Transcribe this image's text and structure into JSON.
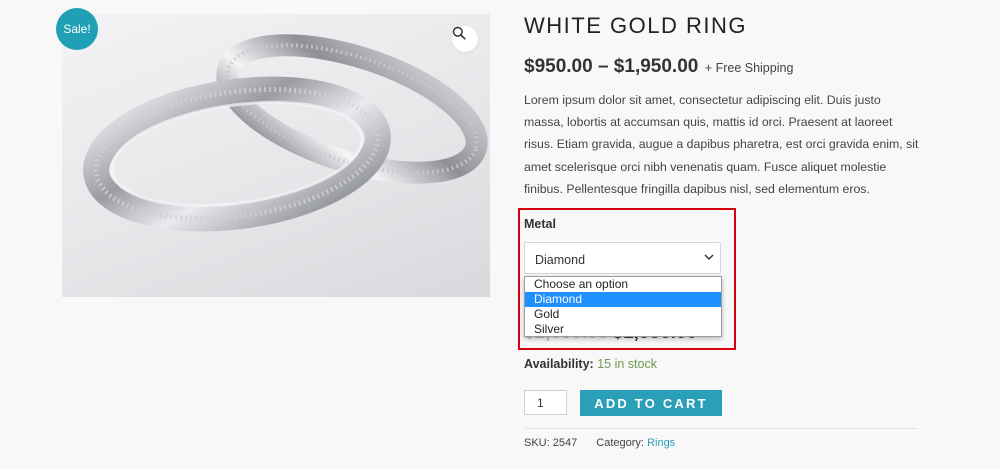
{
  "product": {
    "sale_badge": "Sale!",
    "title": "WHITE GOLD RING",
    "price_range": "$950.00 – $1,950.00",
    "shipping_note": "+ Free Shipping",
    "description": "Lorem ipsum dolor sit amet, consectetur adipiscing elit. Duis justo massa, lobortis at accumsan quis, mattis id orci. Praesent at laoreet risus. Etiam gravida, augue a dapibus pharetra, est orci gravida enim, sit amet scelerisque orci nibh venenatis quam. Fusce aliquet molestie finibus. Pellentesque fringilla dapibus nisl, sed elementum eros."
  },
  "variation": {
    "label": "Metal",
    "selected": "Diamond",
    "options": [
      "Choose an option",
      "Diamond",
      "Gold",
      "Silver"
    ]
  },
  "variation_price": {
    "old": "$2,000.00",
    "new": "$1,950.00"
  },
  "availability": {
    "label": "Availability:",
    "value": "15 in stock"
  },
  "cart": {
    "quantity": "1",
    "button_label": "ADD TO CART"
  },
  "meta": {
    "sku_label": "SKU:",
    "sku": "2547",
    "category_label": "Category:",
    "category": "Rings"
  },
  "colors": {
    "accent": "#2a9fb8",
    "sale": "#1fa0b4",
    "highlight": "#d7000f",
    "in_stock": "#6f9a4c",
    "selected_option": "#1e90ff"
  },
  "icons": {
    "zoom": "search-icon",
    "select_arrow": "chevron-down-icon"
  }
}
